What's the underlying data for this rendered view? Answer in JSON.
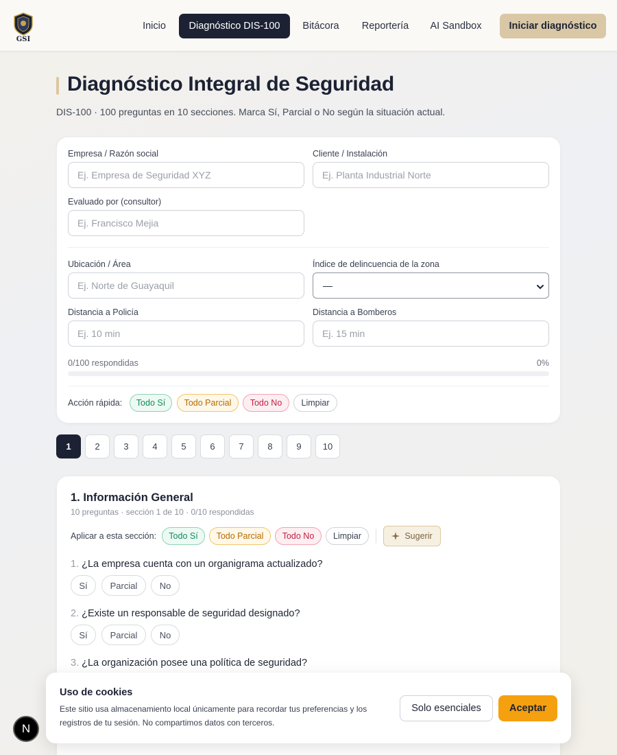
{
  "header": {
    "logo_text": "GSI",
    "nav": [
      "Inicio",
      "Diagnóstico DIS-100",
      "Bitácora",
      "Reportería",
      "AI Sandbox"
    ],
    "cta": "Iniciar diagnóstico"
  },
  "page": {
    "title": "Diagnóstico Integral de Seguridad",
    "subtitle": "DIS-100 · 100 preguntas en 10 secciones. Marca Sí, Parcial o No según la situación actual."
  },
  "form": {
    "empresa_label": "Empresa / Razón social",
    "empresa_placeholder": "Ej. Empresa de Seguridad XYZ",
    "cliente_label": "Cliente / Instalación",
    "cliente_placeholder": "Ej. Planta Industrial Norte",
    "evaluado_label": "Evaluado por (consultor)",
    "evaluado_placeholder": "Ej. Francisco Mejia",
    "ubicacion_label": "Ubicación / Área",
    "ubicacion_placeholder": "Ej. Norte de Guayaquil",
    "indice_label": "Índice de delincuencia de la zona",
    "indice_value": "—",
    "policia_label": "Distancia a Policía",
    "policia_placeholder": "Ej. 10 min",
    "bomberos_label": "Distancia a Bomberos",
    "bomberos_placeholder": "Ej. 15 min"
  },
  "progress": {
    "answered_text": "0/100 respondidas",
    "percent_text": "0%",
    "fraction": 0
  },
  "quick_actions": {
    "label": "Acción rápida:",
    "all_yes": "Todo Sí",
    "all_partial": "Todo Parcial",
    "all_no": "Todo No",
    "clear": "Limpiar"
  },
  "pagination": [
    "1",
    "2",
    "3",
    "4",
    "5",
    "6",
    "7",
    "8",
    "9",
    "10"
  ],
  "section": {
    "title": "1. Información General",
    "subtitle": "10 preguntas · sección 1 de 10 · 0/10 respondidas",
    "apply_label": "Aplicar a esta sección:",
    "all_yes": "Todo Sí",
    "all_partial": "Todo Parcial",
    "all_no": "Todo No",
    "clear": "Limpiar",
    "suggest": "Sugerir",
    "answer_options": [
      "Sí",
      "Parcial",
      "No"
    ],
    "questions": [
      {
        "num": "1.",
        "text": "¿La empresa cuenta con un organigrama actualizado?"
      },
      {
        "num": "2.",
        "text": "¿Existe un responsable de seguridad designado?"
      },
      {
        "num": "3.",
        "text": "¿La organización posee una política de seguridad?"
      }
    ]
  },
  "cookie": {
    "title": "Uso de cookies",
    "text": "Este sitio usa almacenamiento local únicamente para recordar tus preferencias y los registros de tu sesión. No compartimos datos con terceros.",
    "essentials": "Solo esenciales",
    "accept": "Aceptar"
  },
  "dev_badge": "N"
}
